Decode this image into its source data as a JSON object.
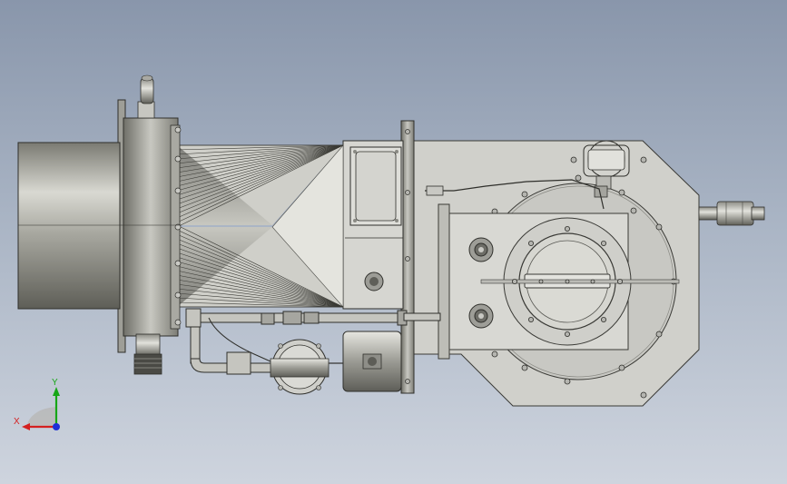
{
  "viewport": {
    "background_top": "#8996ab",
    "background_bottom": "#ced4de"
  },
  "model": {
    "icon": "burner-assembly-cad-model"
  },
  "triad": {
    "x_label": "X",
    "y_label": "Y",
    "x_color": "#d42020",
    "y_color": "#17a617",
    "z_color": "#1e2fd6"
  }
}
